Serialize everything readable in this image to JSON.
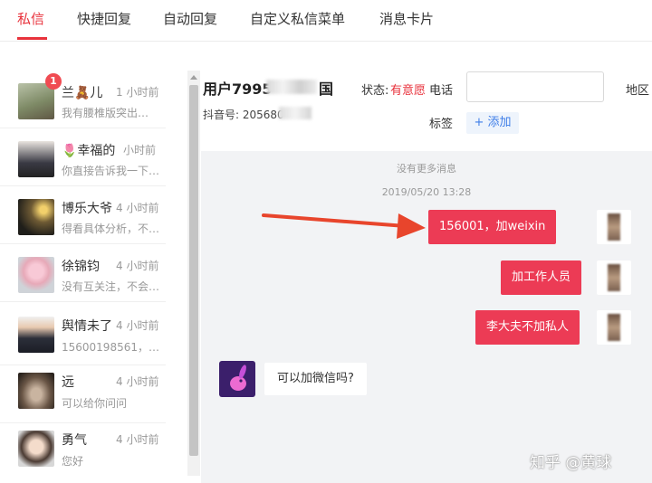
{
  "tabs": [
    {
      "label": "私信",
      "active": true
    },
    {
      "label": "快捷回复"
    },
    {
      "label": "自动回复"
    },
    {
      "label": "自定义私信菜单"
    },
    {
      "label": "消息卡片"
    }
  ],
  "conversations": [
    {
      "name": "兰🧸儿",
      "time": "1 小时前",
      "preview": "我有腰椎版突出…",
      "badge": "1"
    },
    {
      "name": "🌷幸福的…",
      "time": "小时前",
      "preview": "你直接告诉我一下…"
    },
    {
      "name": "博乐大爷",
      "time": "4 小时前",
      "preview": "得看具体分析，不…"
    },
    {
      "name": "徐锦钧",
      "time": "4 小时前",
      "preview": "没有互关注，不会…"
    },
    {
      "name": "舆情未了",
      "time": "4 小时前",
      "preview": "15600198561，加w…"
    },
    {
      "name": "远",
      "time": "4 小时前",
      "preview": "可以给你问问"
    },
    {
      "name": "勇气",
      "time": "4 小时前",
      "preview": "您好"
    }
  ],
  "contact": {
    "name": "用户7995",
    "country": "国",
    "status_label": "状态:",
    "status_value": "有意愿",
    "phone_label": "电话",
    "region_label": "地区",
    "douyin_id": "抖音号: 205680",
    "tag_label": "标签",
    "add_tag": "+ 添加"
  },
  "chat": {
    "no_more": "没有更多消息",
    "timestamp": "2019/05/20 13:28",
    "outgoing": [
      "156001，加weixin",
      "加工作人员",
      "李大夫不加私人"
    ],
    "incoming": [
      "可以加微信吗?"
    ]
  },
  "watermark": "知乎 @黄球",
  "colors": {
    "accent": "#e8323c",
    "bubble": "#ec3b55",
    "link": "#3f7ee8",
    "arrow": "#e8452c"
  }
}
